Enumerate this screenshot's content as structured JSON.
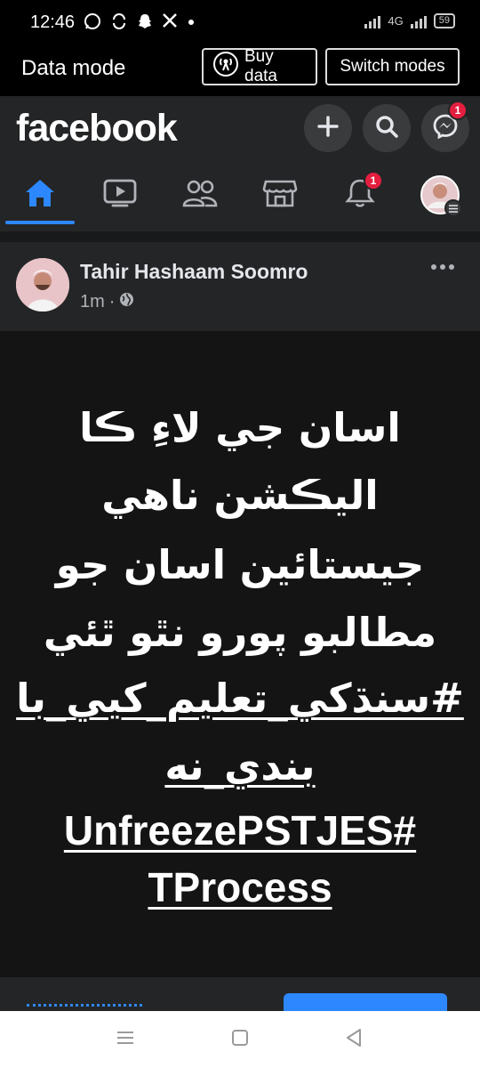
{
  "status_bar": {
    "time": "12:46",
    "network": "4G",
    "battery": "59"
  },
  "data_mode": {
    "label": "Data mode",
    "buy_data": "Buy data",
    "switch_modes": "Switch modes"
  },
  "header": {
    "logo": "facebook",
    "messenger_badge": "1",
    "notifications_badge": "1",
    "active_tab": "home",
    "tabs": [
      "home",
      "video",
      "friends",
      "marketplace",
      "notifications",
      "menu"
    ]
  },
  "post": {
    "author": "Tahir Hashaam Soomro",
    "time": "1m",
    "separator": "·",
    "lines": [
      "اسان جي لاءِ ڪا",
      "اليڪشن ناهي",
      "جيستائين اسان جو",
      "مطالبو پورو نٿو ٿئي",
      "#سنڌکي_تعليم_کيي_با",
      "بندي_نه",
      "UnfreezePSTJES#",
      "TProcess"
    ]
  },
  "colors": {
    "accent": "#2d88ff",
    "badge": "#e41e3f",
    "surface": "#242526",
    "post_bg": "#141414"
  }
}
